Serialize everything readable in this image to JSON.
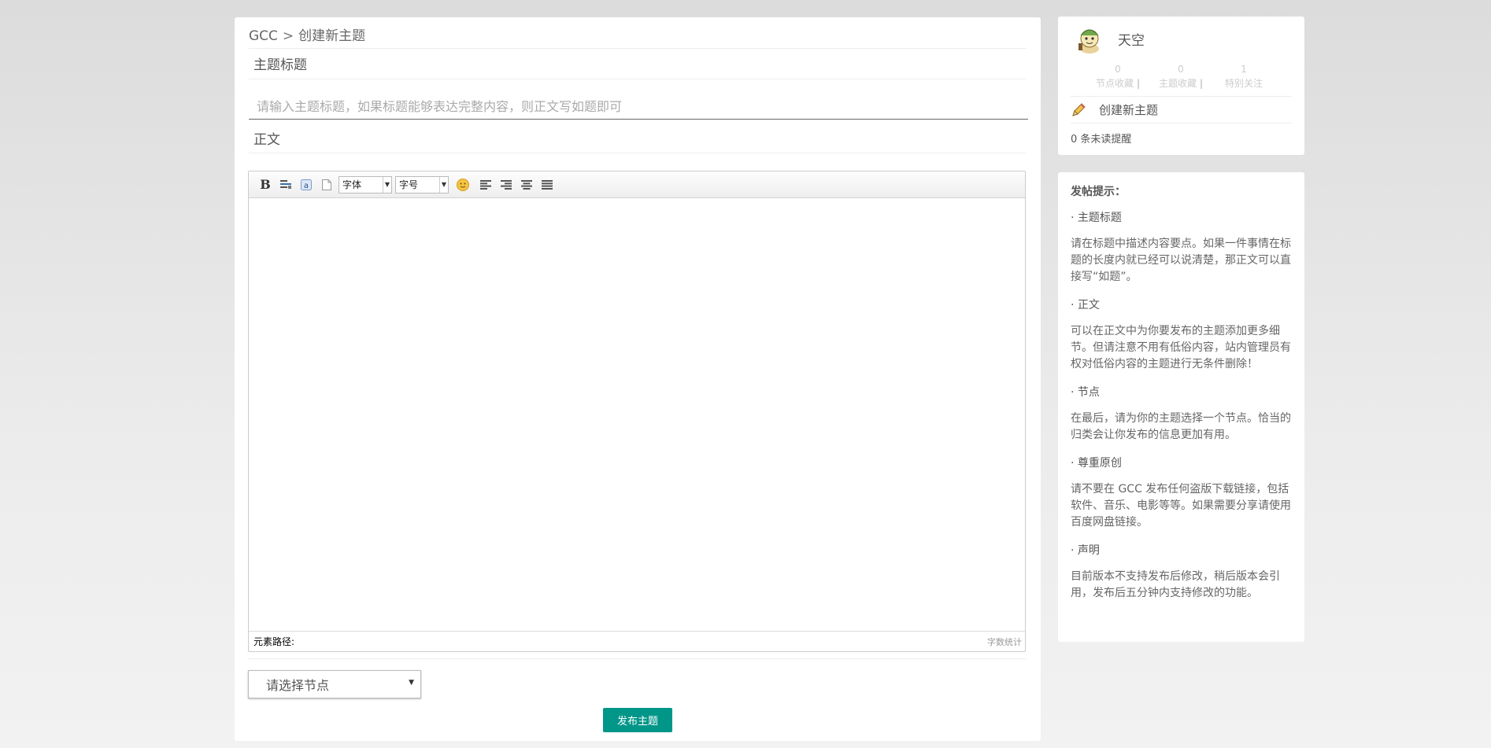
{
  "breadcrumb": {
    "site": "GCC",
    "separator": ">",
    "current": "创建新主题"
  },
  "form": {
    "title_label": "主题标题",
    "title_placeholder": "请输入主题标题，如果标题能够表达完整内容，则正文写如题即可",
    "body_label": "正文",
    "node_select": {
      "selected": "请选择节点"
    },
    "submit_label": "发布主题"
  },
  "editor": {
    "toolbar": {
      "bold_label": "B",
      "font_family": "字体",
      "font_size": "字号",
      "icons": [
        "bold-icon",
        "insert-code-icon",
        "link-icon",
        "page-icon",
        "emoji-icon",
        "align-left-icon",
        "align-right-icon",
        "align-center-icon",
        "align-justify-icon"
      ]
    },
    "footer": {
      "path_label": "元素路径:",
      "word_count_label": "字数统计"
    }
  },
  "user": {
    "name": "天空",
    "stats": [
      {
        "value": "0",
        "label": "节点收藏",
        "bar": "|"
      },
      {
        "value": "0",
        "label": "主题收藏",
        "bar": "|"
      },
      {
        "value": "1",
        "label": "特别关注",
        "bar": ""
      }
    ],
    "create_topic": "创建新主题",
    "unread": "0 条未读提醒"
  },
  "tips": {
    "heading": "发帖提示：",
    "sections": [
      {
        "title": "· 主题标题",
        "body": "请在标题中描述内容要点。如果一件事情在标题的长度内就已经可以说清楚，那正文可以直接写“如题”。"
      },
      {
        "title": "· 正文",
        "body": "可以在正文中为你要发布的主题添加更多细节。但请注意不用有低俗内容，站内管理员有权对低俗内容的主题进行无条件删除！"
      },
      {
        "title": "· 节点",
        "body": "在最后，请为你的主题选择一个节点。恰当的归类会让你发布的信息更加有用。"
      },
      {
        "title": "· 尊重原创",
        "body": "请不要在 GCC 发布任何盗版下载链接，包括软件、音乐、电影等等。如果需要分享请使用百度网盘链接。"
      },
      {
        "title": "· 声明",
        "body": "目前版本不支持发布后修改，稍后版本会引用，发布后五分钟内支持修改的功能。"
      }
    ]
  },
  "colors": {
    "accent": "#009688",
    "background": "#e6e6e6",
    "panel": "#ffffff"
  }
}
